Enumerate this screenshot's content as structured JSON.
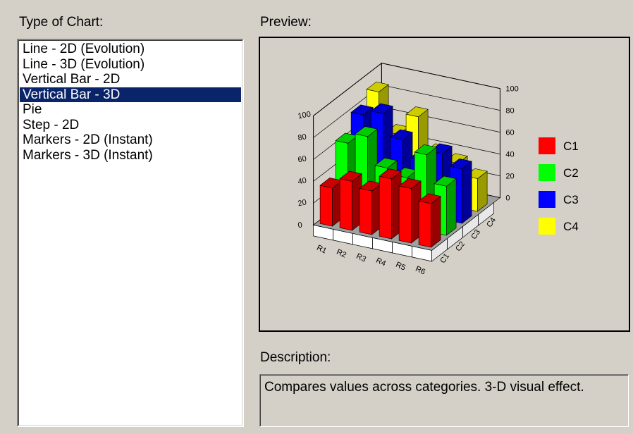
{
  "chart_type_panel": {
    "label": "Type of Chart:",
    "items": [
      {
        "label": "Line - 2D (Evolution)",
        "selected": false
      },
      {
        "label": "Line - 3D (Evolution)",
        "selected": false
      },
      {
        "label": "Vertical Bar - 2D",
        "selected": false
      },
      {
        "label": "Vertical Bar - 3D",
        "selected": true
      },
      {
        "label": "Pie",
        "selected": false
      },
      {
        "label": "Step - 2D",
        "selected": false
      },
      {
        "label": "Markers - 2D (Instant)",
        "selected": false
      },
      {
        "label": "Markers - 3D (Instant)",
        "selected": false
      }
    ],
    "selection_color": "#0a246a"
  },
  "preview": {
    "label": "Preview:",
    "chart_data": {
      "type": "bar",
      "variant": "3d-column",
      "y_ticks": [
        "0",
        "20",
        "40",
        "60",
        "80",
        "100"
      ],
      "ylim": [
        0,
        100
      ],
      "categories": [
        "R1",
        "R2",
        "R3",
        "R4",
        "R5",
        "R6"
      ],
      "series": [
        {
          "name": "C1",
          "color": "#ff0000",
          "values": [
            35,
            45,
            40,
            55,
            50,
            40
          ]
        },
        {
          "name": "C2",
          "color": "#00ff00",
          "values": [
            65,
            75,
            50,
            45,
            70,
            45
          ]
        },
        {
          "name": "C3",
          "color": "#0000ff",
          "values": [
            80,
            85,
            65,
            50,
            60,
            50
          ]
        },
        {
          "name": "C4",
          "color": "#ffff00",
          "values": [
            90,
            55,
            75,
            45,
            40,
            30
          ]
        }
      ],
      "legend": {
        "placement": "right"
      },
      "grid": true
    }
  },
  "description": {
    "label": "Description:",
    "text": "Compares values across categories. 3-D visual effect."
  }
}
